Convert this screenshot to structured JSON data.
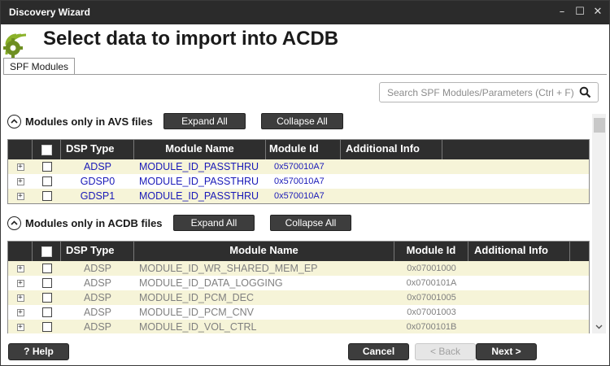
{
  "window": {
    "title": "Discovery Wizard"
  },
  "header": {
    "title": "Select data to import into ACDB"
  },
  "tabs": [
    {
      "label": "SPF Modules"
    }
  ],
  "search": {
    "placeholder": "Search SPF Modules/Parameters (Ctrl + F)"
  },
  "avs_section": {
    "title": "Modules only in AVS files",
    "expand_label": "Expand All",
    "collapse_label": "Collapse All",
    "columns": [
      "DSP Type",
      "Module Name",
      "Module Id",
      "Additional Info"
    ],
    "rows": [
      {
        "dsp": "ADSP",
        "module": "MODULE_ID_PASSTHRU",
        "id": "0x570010A7",
        "info": ""
      },
      {
        "dsp": "GDSP0",
        "module": "MODULE_ID_PASSTHRU",
        "id": "0x570010A7",
        "info": ""
      },
      {
        "dsp": "GDSP1",
        "module": "MODULE_ID_PASSTHRU",
        "id": "0x570010A7",
        "info": ""
      }
    ]
  },
  "acdb_section": {
    "title": "Modules only in ACDB files",
    "expand_label": "Expand All",
    "collapse_label": "Collapse All",
    "columns": [
      "DSP Type",
      "Module Name",
      "Module Id",
      "Additional Info"
    ],
    "rows": [
      {
        "dsp": "ADSP",
        "module": "MODULE_ID_WR_SHARED_MEM_EP",
        "id": "0x07001000",
        "info": ""
      },
      {
        "dsp": "ADSP",
        "module": "MODULE_ID_DATA_LOGGING",
        "id": "0x0700101A",
        "info": ""
      },
      {
        "dsp": "ADSP",
        "module": "MODULE_ID_PCM_DEC",
        "id": "0x07001005",
        "info": ""
      },
      {
        "dsp": "ADSP",
        "module": "MODULE_ID_PCM_CNV",
        "id": "0x07001003",
        "info": ""
      },
      {
        "dsp": "ADSP",
        "module": "MODULE_ID_VOL_CTRL",
        "id": "0x0700101B",
        "info": ""
      }
    ]
  },
  "footer": {
    "help_label": "? Help",
    "cancel_label": "Cancel",
    "back_label": "< Back",
    "next_label": "Next >"
  },
  "colors": {
    "titlebar": "#2b2b2b",
    "row_highlight": "#f6f4d8",
    "avs_text": "#1a1ab8",
    "acdb_text": "#808080"
  }
}
